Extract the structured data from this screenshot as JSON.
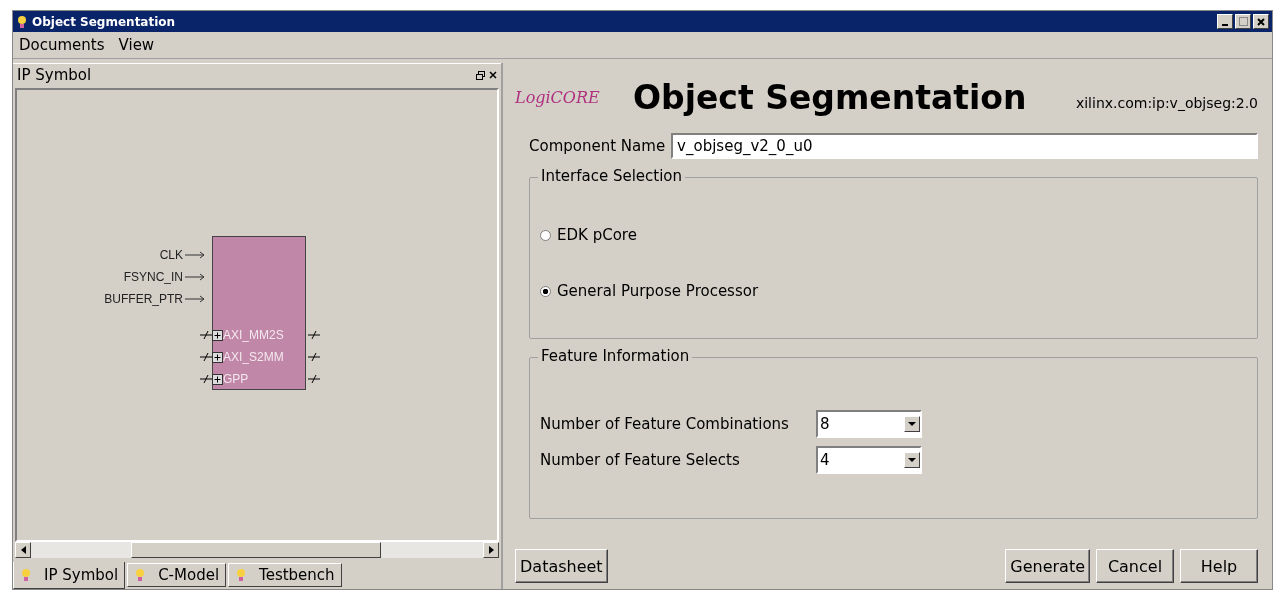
{
  "window": {
    "title": "Object Segmentation"
  },
  "menu": [
    "Documents",
    "View"
  ],
  "left_panel": {
    "title": "IP Symbol",
    "symbol": {
      "inputs": [
        "CLK",
        "FSYNC_IN",
        "BUFFER_PTR"
      ],
      "buses": [
        "AXI_MM2S",
        "AXI_S2MM",
        "GPP"
      ]
    },
    "tabs": [
      {
        "label": "IP Symbol",
        "selected": true
      },
      {
        "label": "C-Model",
        "selected": false
      },
      {
        "label": "Testbench",
        "selected": false
      }
    ]
  },
  "header": {
    "logo": "LogiCORE",
    "title": "Object Segmentation",
    "ip_id": "xilinx.com:ip:v_objseg:2.0"
  },
  "component_name": {
    "label": "Component Name",
    "value": "v_objseg_v2_0_u0"
  },
  "interface_selection": {
    "title": "Interface Selection",
    "options": [
      {
        "label": "EDK pCore",
        "selected": false
      },
      {
        "label": "General Purpose Processor",
        "selected": true
      }
    ]
  },
  "feature_information": {
    "title": "Feature Information",
    "fields": [
      {
        "label": "Number of Feature Combinations",
        "value": "8"
      },
      {
        "label": "Number of Feature Selects",
        "value": "4"
      }
    ]
  },
  "buttons_left": [
    "Datasheet"
  ],
  "buttons_right": [
    "Generate",
    "Cancel",
    "Help"
  ]
}
